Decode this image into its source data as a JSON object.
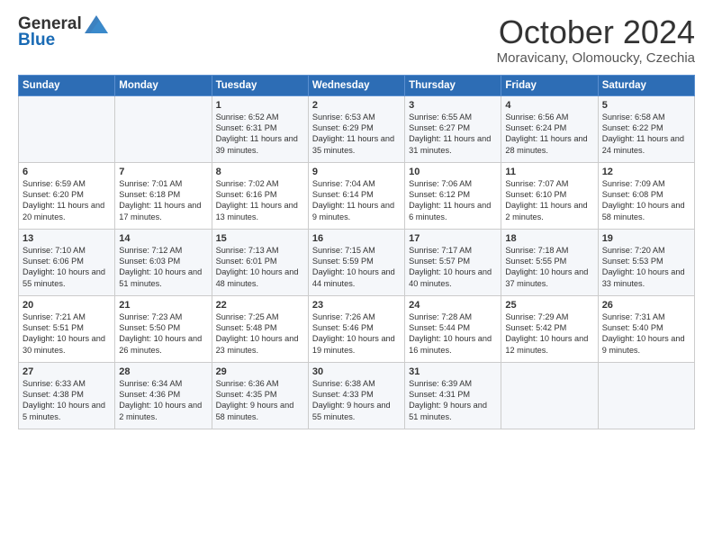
{
  "header": {
    "logo_line1": "General",
    "logo_line2": "Blue",
    "month": "October 2024",
    "location": "Moravicany, Olomoucky, Czechia"
  },
  "weekdays": [
    "Sunday",
    "Monday",
    "Tuesday",
    "Wednesday",
    "Thursday",
    "Friday",
    "Saturday"
  ],
  "weeks": [
    [
      {
        "day": "",
        "info": ""
      },
      {
        "day": "",
        "info": ""
      },
      {
        "day": "1",
        "info": "Sunrise: 6:52 AM\nSunset: 6:31 PM\nDaylight: 11 hours and 39 minutes."
      },
      {
        "day": "2",
        "info": "Sunrise: 6:53 AM\nSunset: 6:29 PM\nDaylight: 11 hours and 35 minutes."
      },
      {
        "day": "3",
        "info": "Sunrise: 6:55 AM\nSunset: 6:27 PM\nDaylight: 11 hours and 31 minutes."
      },
      {
        "day": "4",
        "info": "Sunrise: 6:56 AM\nSunset: 6:24 PM\nDaylight: 11 hours and 28 minutes."
      },
      {
        "day": "5",
        "info": "Sunrise: 6:58 AM\nSunset: 6:22 PM\nDaylight: 11 hours and 24 minutes."
      }
    ],
    [
      {
        "day": "6",
        "info": "Sunrise: 6:59 AM\nSunset: 6:20 PM\nDaylight: 11 hours and 20 minutes."
      },
      {
        "day": "7",
        "info": "Sunrise: 7:01 AM\nSunset: 6:18 PM\nDaylight: 11 hours and 17 minutes."
      },
      {
        "day": "8",
        "info": "Sunrise: 7:02 AM\nSunset: 6:16 PM\nDaylight: 11 hours and 13 minutes."
      },
      {
        "day": "9",
        "info": "Sunrise: 7:04 AM\nSunset: 6:14 PM\nDaylight: 11 hours and 9 minutes."
      },
      {
        "day": "10",
        "info": "Sunrise: 7:06 AM\nSunset: 6:12 PM\nDaylight: 11 hours and 6 minutes."
      },
      {
        "day": "11",
        "info": "Sunrise: 7:07 AM\nSunset: 6:10 PM\nDaylight: 11 hours and 2 minutes."
      },
      {
        "day": "12",
        "info": "Sunrise: 7:09 AM\nSunset: 6:08 PM\nDaylight: 10 hours and 58 minutes."
      }
    ],
    [
      {
        "day": "13",
        "info": "Sunrise: 7:10 AM\nSunset: 6:06 PM\nDaylight: 10 hours and 55 minutes."
      },
      {
        "day": "14",
        "info": "Sunrise: 7:12 AM\nSunset: 6:03 PM\nDaylight: 10 hours and 51 minutes."
      },
      {
        "day": "15",
        "info": "Sunrise: 7:13 AM\nSunset: 6:01 PM\nDaylight: 10 hours and 48 minutes."
      },
      {
        "day": "16",
        "info": "Sunrise: 7:15 AM\nSunset: 5:59 PM\nDaylight: 10 hours and 44 minutes."
      },
      {
        "day": "17",
        "info": "Sunrise: 7:17 AM\nSunset: 5:57 PM\nDaylight: 10 hours and 40 minutes."
      },
      {
        "day": "18",
        "info": "Sunrise: 7:18 AM\nSunset: 5:55 PM\nDaylight: 10 hours and 37 minutes."
      },
      {
        "day": "19",
        "info": "Sunrise: 7:20 AM\nSunset: 5:53 PM\nDaylight: 10 hours and 33 minutes."
      }
    ],
    [
      {
        "day": "20",
        "info": "Sunrise: 7:21 AM\nSunset: 5:51 PM\nDaylight: 10 hours and 30 minutes."
      },
      {
        "day": "21",
        "info": "Sunrise: 7:23 AM\nSunset: 5:50 PM\nDaylight: 10 hours and 26 minutes."
      },
      {
        "day": "22",
        "info": "Sunrise: 7:25 AM\nSunset: 5:48 PM\nDaylight: 10 hours and 23 minutes."
      },
      {
        "day": "23",
        "info": "Sunrise: 7:26 AM\nSunset: 5:46 PM\nDaylight: 10 hours and 19 minutes."
      },
      {
        "day": "24",
        "info": "Sunrise: 7:28 AM\nSunset: 5:44 PM\nDaylight: 10 hours and 16 minutes."
      },
      {
        "day": "25",
        "info": "Sunrise: 7:29 AM\nSunset: 5:42 PM\nDaylight: 10 hours and 12 minutes."
      },
      {
        "day": "26",
        "info": "Sunrise: 7:31 AM\nSunset: 5:40 PM\nDaylight: 10 hours and 9 minutes."
      }
    ],
    [
      {
        "day": "27",
        "info": "Sunrise: 6:33 AM\nSunset: 4:38 PM\nDaylight: 10 hours and 5 minutes."
      },
      {
        "day": "28",
        "info": "Sunrise: 6:34 AM\nSunset: 4:36 PM\nDaylight: 10 hours and 2 minutes."
      },
      {
        "day": "29",
        "info": "Sunrise: 6:36 AM\nSunset: 4:35 PM\nDaylight: 9 hours and 58 minutes."
      },
      {
        "day": "30",
        "info": "Sunrise: 6:38 AM\nSunset: 4:33 PM\nDaylight: 9 hours and 55 minutes."
      },
      {
        "day": "31",
        "info": "Sunrise: 6:39 AM\nSunset: 4:31 PM\nDaylight: 9 hours and 51 minutes."
      },
      {
        "day": "",
        "info": ""
      },
      {
        "day": "",
        "info": ""
      }
    ]
  ]
}
